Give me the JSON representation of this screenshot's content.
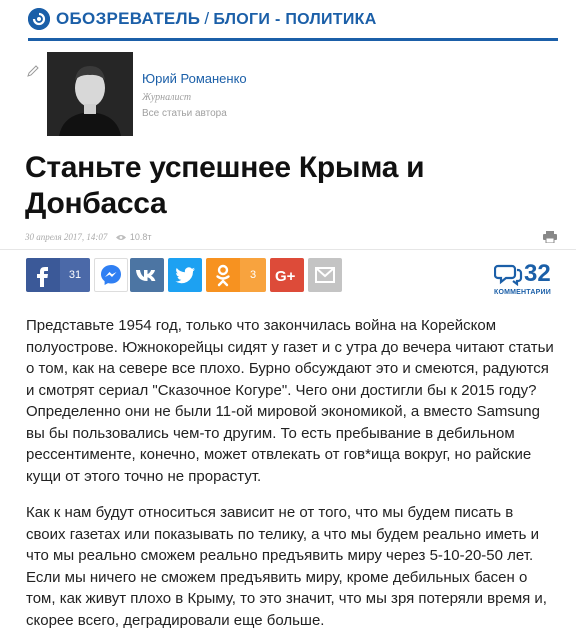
{
  "header": {
    "brand": "ОБОЗРЕВАТЕЛЬ",
    "separator": "/",
    "crumb": "БЛОГИ - ПОЛИТИКА",
    "brand_color": "#1b5fa8"
  },
  "author": {
    "name": "Юрий Романенко",
    "role": "Журналист",
    "all_articles": "Все статьи автора"
  },
  "article": {
    "title": "Станьте успешнее Крыма и Донбасса",
    "date": "30 апреля 2017, 14:07",
    "views": "10.8т",
    "paragraphs": [
      "Представьте 1954 год, только что закончилась война на Корейском полуострове. Южнокорейцы сидят у газет и с утра до вечера читают статьи о том, как на севере все плохо. Бурно обсуждают это и смеются, радуются и смотрят сериал \"Сказочное Когуре\". Чего они достигли бы к 2015 году? Определенно они не были 11-ой мировой экономикой, а вместо Samsung вы бы пользовались чем-то другим. То есть пребывание в дебильном рессентименте, конечно, может отвлекать от гов*ища вокруг, но райские кущи от этого точно не прорастут.",
      "Как к нам будут относиться зависит не от того, что мы будем писать в своих газетах или показывать по телику, а что мы будем реально иметь и что мы реально сможем реально предъявить миру через 5-10-20-50 лет. Если мы ничего не сможем предъявить миру, кроме дебильных басен о том, как живут плохо в Крыму, то это значит, что мы зря потеряли время и, скорее всего, деградировали еще больше."
    ]
  },
  "share": {
    "facebook_count": "31",
    "odnoklassniki_count": "3",
    "buttons": [
      {
        "name": "facebook",
        "color": "#3b5998",
        "icon": "facebook-icon"
      },
      {
        "name": "messenger",
        "color": "#2f7ff3",
        "icon": "messenger-icon"
      },
      {
        "name": "vkontakte",
        "color": "#4c75a3",
        "icon": "vk-icon"
      },
      {
        "name": "twitter",
        "color": "#1da1f2",
        "icon": "twitter-icon"
      },
      {
        "name": "odnoklassniki",
        "color": "#f79220",
        "icon": "ok-icon"
      },
      {
        "name": "google-plus",
        "color": "#dd4b39",
        "icon": "google-plus-icon"
      },
      {
        "name": "email",
        "color": "#b8b8b8",
        "icon": "envelope-icon"
      }
    ]
  },
  "comments": {
    "count": "32",
    "label": "КОММЕНТАРИИ"
  }
}
